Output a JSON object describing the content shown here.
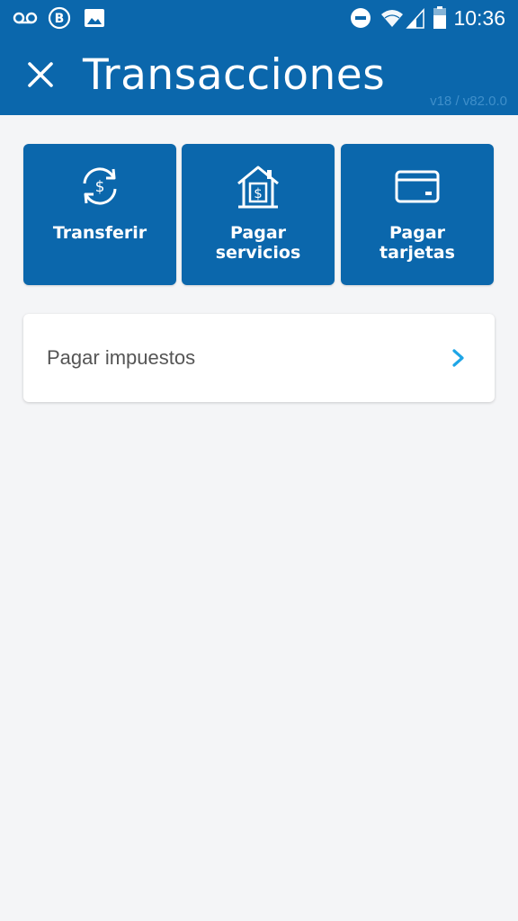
{
  "status_bar": {
    "time": "10:36",
    "icons": [
      "voicemail-icon",
      "b-app-icon",
      "image-icon",
      "do-not-disturb-icon",
      "wifi-icon",
      "signal-icon",
      "battery-icon"
    ]
  },
  "header": {
    "title": "Transacciones",
    "version": "v18 / v82.0.0",
    "close_icon": "close-icon",
    "color": "#0b67ac"
  },
  "actions": [
    {
      "label_lines": [
        "Transferir"
      ],
      "icon": "transfer-money-icon"
    },
    {
      "label_lines": [
        "Pagar",
        "servicios"
      ],
      "icon": "house-money-icon"
    },
    {
      "label_lines": [
        "Pagar",
        "tarjetas"
      ],
      "icon": "credit-card-icon"
    }
  ],
  "list": [
    {
      "label": "Pagar impuestos",
      "icon": "chevron-right-icon",
      "accent": "#1ea5e6"
    }
  ]
}
